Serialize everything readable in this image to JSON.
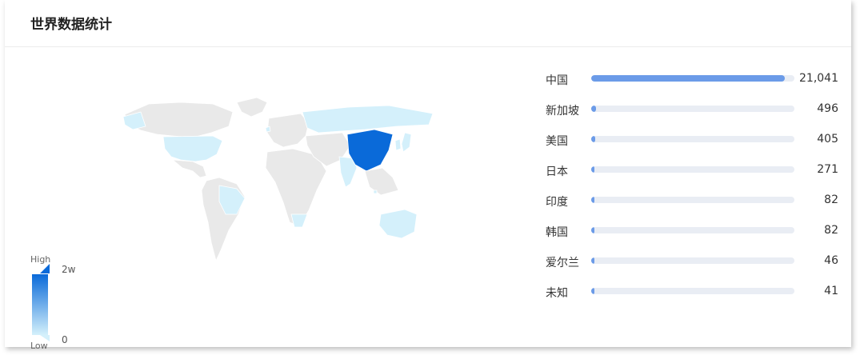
{
  "card": {
    "title": "世界数据统计"
  },
  "legend": {
    "high": "High",
    "low": "Low",
    "max_label": "2w",
    "min_label": "0"
  },
  "chart_data": {
    "type": "table",
    "title": "世界数据统计",
    "max": 21041,
    "categories": [
      "中国",
      "新加坡",
      "美国",
      "日本",
      "印度",
      "韩国",
      "爱尔兰",
      "未知"
    ],
    "values": [
      21041,
      496,
      405,
      271,
      82,
      82,
      46,
      41
    ],
    "value_labels": [
      "21,041",
      "496",
      "405",
      "271",
      "82",
      "82",
      "46",
      "41"
    ],
    "colors": {
      "highlight": "#0a6ad9",
      "light": "#d4f0fb",
      "land": "#e9e9e9",
      "bar": "#6b9be8",
      "track": "#e9edf4"
    }
  }
}
